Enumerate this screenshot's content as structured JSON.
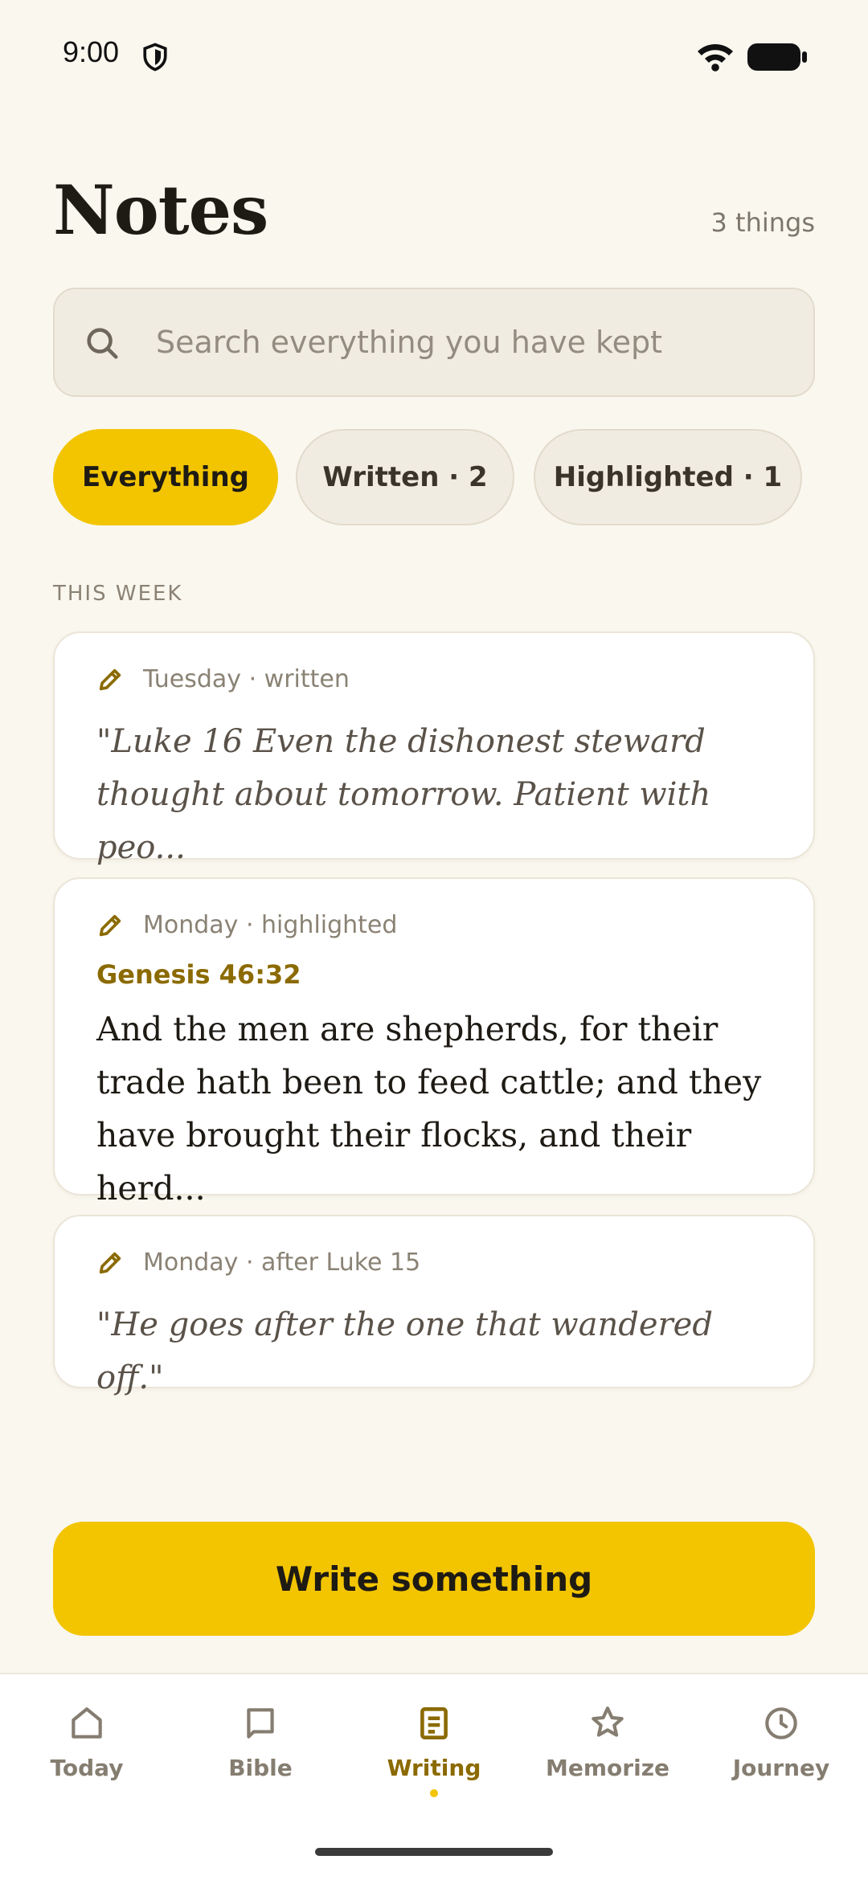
{
  "status_bar": {
    "time": "9:00"
  },
  "header": {
    "title": "Notes",
    "count": "3 things"
  },
  "search": {
    "placeholder": "Search everything you have kept",
    "value": ""
  },
  "filters": [
    {
      "label": "Everything",
      "active": true
    },
    {
      "label": "Written · 2",
      "active": false
    },
    {
      "label": "Highlighted · 1",
      "active": false
    }
  ],
  "section": {
    "label": "THIS WEEK"
  },
  "notes": [
    {
      "meta": "Tuesday · written",
      "text": "\"Luke 16 Even the dishonest steward thought about tomorrow. Patient with peo..."
    },
    {
      "meta": "Monday · highlighted",
      "reference": "Genesis 46:32",
      "text": "And the men are shepherds, for their trade hath been to feed cattle; and they have brought their flocks, and their herd..."
    },
    {
      "meta": "Monday · after Luke 15",
      "text": "\"He goes after the one that wandered off.\""
    }
  ],
  "actions": {
    "write_label": "Write something"
  },
  "nav": {
    "items": [
      {
        "label": "Today",
        "icon": "home-icon"
      },
      {
        "label": "Bible",
        "icon": "book-icon"
      },
      {
        "label": "Writing",
        "icon": "document-icon",
        "active": true
      },
      {
        "label": "Memorize",
        "icon": "star-icon"
      },
      {
        "label": "Journey",
        "icon": "clock-icon"
      }
    ]
  },
  "colors": {
    "accent": "#f2c500",
    "accent_text": "#8b6a00",
    "background": "#faf7ef"
  }
}
